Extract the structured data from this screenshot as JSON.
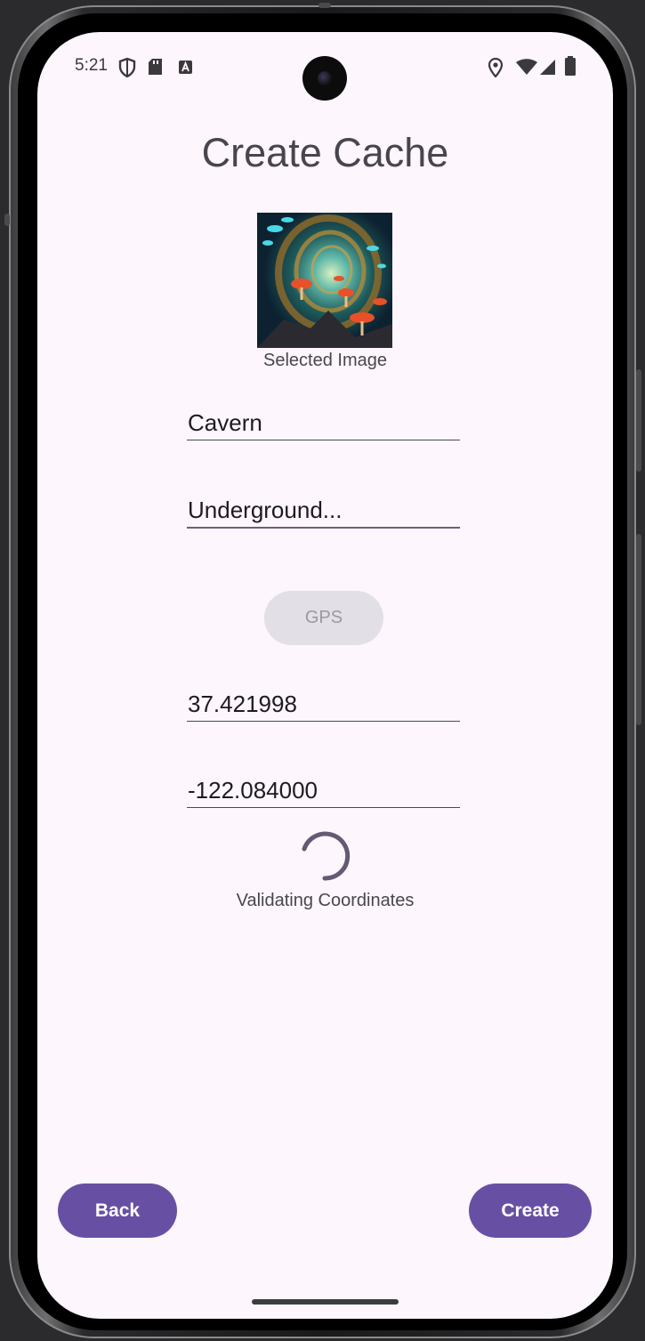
{
  "status_bar": {
    "time": "5:21",
    "left_icons": [
      "shield-icon",
      "sd-card-icon",
      "a-badge-icon"
    ],
    "right_icons": [
      "location-icon",
      "wifi-icon",
      "signal-icon",
      "battery-icon"
    ]
  },
  "screen": {
    "title": "Create Cache",
    "image_caption": "Selected Image",
    "name_field": {
      "value": "Cavern"
    },
    "description_field": {
      "value": "Underground..."
    },
    "gps_button": {
      "label": "GPS",
      "state": "disabled"
    },
    "latitude_field": {
      "value": "37.421998"
    },
    "longitude_field": {
      "value": "-122.084000"
    },
    "progress_text": "Validating Coordinates",
    "back_button": {
      "label": "Back"
    },
    "create_button": {
      "label": "Create"
    }
  },
  "colors": {
    "primary": "#6750a4",
    "background": "#fdf6fc",
    "text": "#49454f",
    "disabled_button": "#e3dfe6"
  }
}
